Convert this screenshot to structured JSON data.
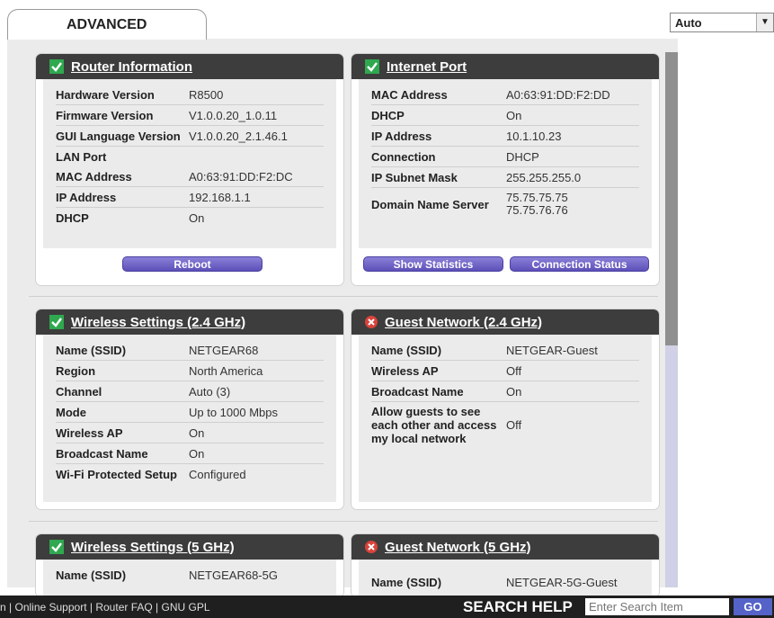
{
  "tab": {
    "label": "ADVANCED"
  },
  "language": {
    "selected": "Auto"
  },
  "router_info": {
    "title": "Router Information",
    "rows": [
      {
        "label": "Hardware Version",
        "value": "R8500"
      },
      {
        "label": "Firmware Version",
        "value": "V1.0.0.20_1.0.11"
      },
      {
        "label": "GUI Language Version",
        "value": "V1.0.0.20_2.1.46.1"
      },
      {
        "label": "LAN Port",
        "value": ""
      },
      {
        "label": "MAC Address",
        "value": "A0:63:91:DD:F2:DC"
      },
      {
        "label": "IP Address",
        "value": "192.168.1.1"
      },
      {
        "label": "DHCP",
        "value": "On"
      }
    ],
    "reboot_label": "Reboot"
  },
  "internet_port": {
    "title": "Internet Port",
    "rows": [
      {
        "label": "MAC Address",
        "value": "A0:63:91:DD:F2:DD"
      },
      {
        "label": "DHCP",
        "value": "On"
      },
      {
        "label": "IP Address",
        "value": "10.1.10.23"
      },
      {
        "label": "Connection",
        "value": "DHCP"
      },
      {
        "label": "IP Subnet Mask",
        "value": "255.255.255.0"
      },
      {
        "label": "Domain Name Server",
        "value": "75.75.75.75",
        "value2": "75.75.76.76"
      }
    ],
    "show_stats_label": "Show Statistics",
    "conn_status_label": "Connection Status"
  },
  "wireless_24": {
    "title": "Wireless Settings (2.4 GHz)",
    "rows": [
      {
        "label": "Name (SSID)",
        "value": "NETGEAR68"
      },
      {
        "label": "Region",
        "value": "North America"
      },
      {
        "label": "Channel",
        "value": "Auto (3)"
      },
      {
        "label": "Mode",
        "value": "Up to 1000 Mbps"
      },
      {
        "label": "Wireless AP",
        "value": "On"
      },
      {
        "label": "Broadcast Name",
        "value": "On"
      },
      {
        "label": "Wi-Fi Protected Setup",
        "value": "Configured"
      }
    ]
  },
  "guest_24": {
    "title": "Guest Network (2.4 GHz)",
    "rows": [
      {
        "label": "Name (SSID)",
        "value": "NETGEAR-Guest"
      },
      {
        "label": "Wireless AP",
        "value": "Off"
      },
      {
        "label": "Broadcast Name",
        "value": "On"
      },
      {
        "label_lines": [
          "Allow guests to see",
          "each other and access",
          "my local network"
        ],
        "value": "Off"
      }
    ]
  },
  "wireless_5": {
    "title": "Wireless Settings (5 GHz)",
    "rows": [
      {
        "label": "Name (SSID)",
        "value": "NETGEAR68-5G"
      }
    ]
  },
  "guest_5": {
    "title": "Guest Network (5 GHz)",
    "rows": [
      {
        "label": "Name (SSID)",
        "value": "NETGEAR-5G-Guest"
      }
    ]
  },
  "footer": {
    "links_prefix": "n",
    "links": [
      "Online Support",
      "Router FAQ",
      "GNU GPL"
    ],
    "search_help_label": "SEARCH HELP",
    "search_placeholder": "Enter Search Item",
    "go_label": "GO"
  },
  "colors": {
    "panel_header": "#3d3d3d",
    "ok_green": "#2fa84f",
    "error_red": "#d9433a",
    "button_purple": "#6a5ec6",
    "link_blue": "#2a8ad0"
  }
}
